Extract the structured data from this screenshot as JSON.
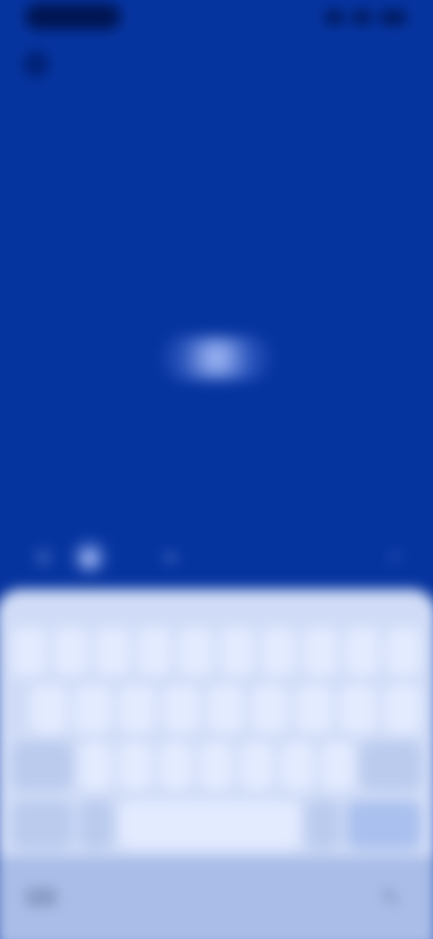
{
  "status_bar": {
    "left_text": "",
    "icons": [
      "signal-icon",
      "wifi-icon",
      "battery-icon"
    ]
  },
  "top_left": {
    "icon": "back-arrow-icon",
    "glyph": "‹"
  },
  "center": {
    "label": ""
  },
  "toolbar": {
    "items": [
      {
        "icon": "emoji-icon",
        "glyph": "☺"
      },
      {
        "icon": "gif-icon",
        "glyph": "◉"
      },
      {
        "icon": "attachment-icon",
        "glyph": "⌁"
      },
      {
        "icon": "mic-icon",
        "glyph": "◦"
      }
    ]
  },
  "keyboard": {
    "row1": [
      "",
      "",
      "",
      "",
      "",
      "",
      "",
      "",
      "",
      ""
    ],
    "row2": [
      "",
      "",
      "",
      "",
      "",
      "",
      "",
      "",
      ""
    ],
    "row3": [
      "",
      "",
      "",
      "",
      "",
      "",
      "",
      "",
      ""
    ],
    "row4": [
      "",
      "",
      "",
      "",
      ""
    ]
  },
  "nav_bar": {
    "left_icon": "keyboard-icon",
    "left_glyph": "⌨",
    "right_icon": "handwriting-icon",
    "right_glyph": "✎"
  }
}
